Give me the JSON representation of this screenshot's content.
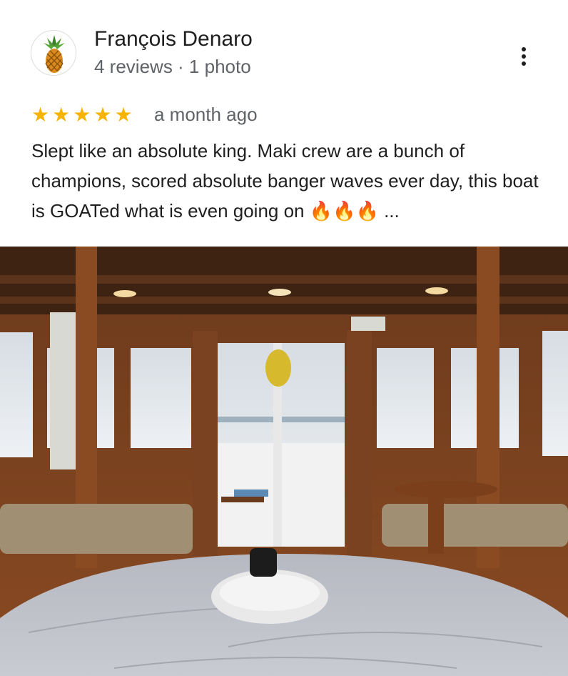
{
  "review": {
    "author_name": "François Denaro",
    "author_meta": "4 reviews · 1 photo",
    "rating": 5,
    "stars": [
      "★",
      "★",
      "★",
      "★",
      "★"
    ],
    "date": "a month ago",
    "text": "Slept like an absolute king. Maki crew are a bunch of champions, scored absolute banger waves ever day, this boat is GOATed what is even going on 🔥🔥🔥 ..."
  },
  "icons": {
    "avatar": "pineapple-icon",
    "menu": "more-vert-icon",
    "star": "star-icon"
  },
  "colors": {
    "star": "#f6b400",
    "secondary_text": "#5f6368",
    "primary_text": "#1f1f1f"
  }
}
